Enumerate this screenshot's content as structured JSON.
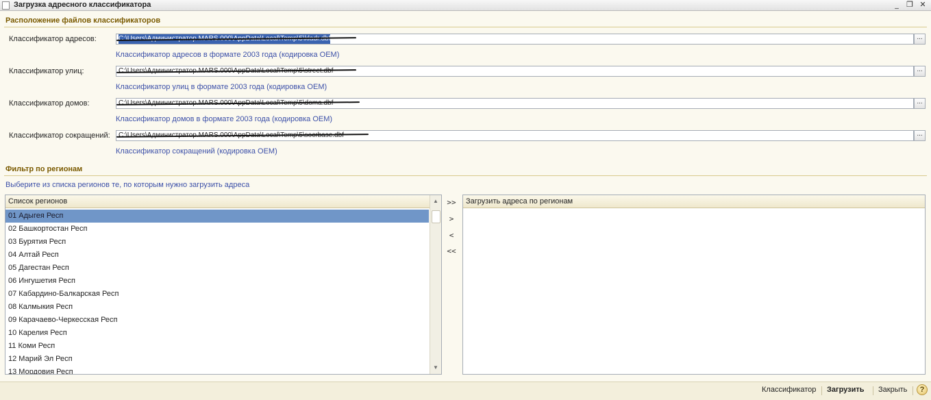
{
  "window": {
    "title": "Загрузка адресного классификатора",
    "minimize_glyph": "_",
    "restore_glyph": "❐",
    "close_glyph": "✕"
  },
  "files_section": {
    "title": "Расположение файлов классификаторов",
    "browse_label": "...",
    "fields": [
      {
        "label": "Классификатор адресов:",
        "value": "C:\\Users\\Администратор.MARS.000\\AppData\\Local\\Temp\\5\\kladr.dbf",
        "hint": "Классификатор адресов в формате  2003 года  (кодировка OEM)"
      },
      {
        "label": "Классификатор улиц:",
        "value": "C:\\Users\\Администратор.MARS.000\\AppData\\Local\\Temp\\5\\street.dbf",
        "hint": "Классификатор улиц в формате  2003 года  (кодировка OEM)"
      },
      {
        "label": "Классификатор домов:",
        "value": "C:\\Users\\Администратор.MARS.000\\AppData\\Local\\Temp\\5\\doma.dbf",
        "hint": "Классификатор домов в формате  2003 года  (кодировка OEM)"
      },
      {
        "label": "Классификатор сокращений:",
        "value": "C:\\Users\\Администратор.MARS.000\\AppData\\Local\\Temp\\5\\socrbase.dbf",
        "hint": "Классификатор сокращений (кодировка OEM)"
      }
    ]
  },
  "filter_section": {
    "title": "Фильтр по регионам",
    "hint": "Выберите из списка регионов те, по которым нужно загрузить адреса"
  },
  "region_list": {
    "header": "Список регионов",
    "items": [
      "01 Адыгея Респ",
      "02 Башкортостан Респ",
      "03 Бурятия Респ",
      "04 Алтай Респ",
      "05 Дагестан Респ",
      "06 Ингушетия Респ",
      "07 Кабардино-Балкарская Респ",
      "08 Калмыкия Респ",
      "09 Карачаево-Черкесская Респ",
      "10 Карелия Респ",
      "11 Коми Респ",
      "12 Марий Эл Респ",
      "13 Мордовия Респ"
    ],
    "selected_index": 0,
    "scroll_up": "▲",
    "scroll_down": "▼"
  },
  "move_buttons": {
    "add_all": ">>",
    "add_one": ">",
    "remove_one": "<",
    "remove_all": "<<"
  },
  "target_list": {
    "header": "Загрузить адреса по регионам"
  },
  "footer": {
    "classifier": "Классификатор",
    "load": "Загрузить",
    "close": "Закрыть",
    "help": "?"
  }
}
